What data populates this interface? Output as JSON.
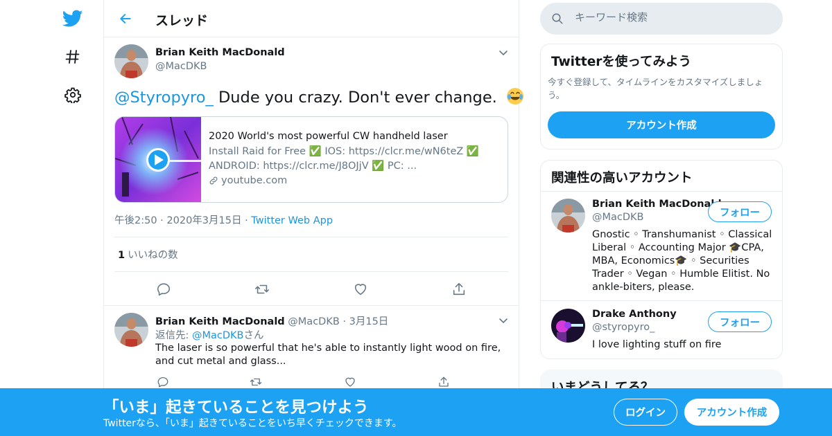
{
  "colors": {
    "accent": "#1da1f2",
    "link": "#1b95e0",
    "muted": "#657786",
    "border": "#e6ecf0"
  },
  "nav": {
    "icons": [
      "twitter-bird-icon",
      "hashtag-icon",
      "gear-icon"
    ]
  },
  "header": {
    "title": "スレッド"
  },
  "main_tweet": {
    "author_name": "Brian Keith MacDonald",
    "author_handle": "@MacDKB",
    "mention": "@Styropyro_",
    "text": "Dude you crazy. Don't ever change.",
    "emoji": "joy-emoji",
    "card": {
      "title": "2020 World's most powerful CW handheld laser",
      "description": "Install Raid for Free ✅ IOS: https://clcr.me/wN6teZ ✅ ANDROID: https://clcr.me/J8OJjV ✅ PC: ...",
      "domain": "youtube.com"
    },
    "time": "午後2:50",
    "date": "2020年3月15日",
    "source": "Twitter Web App",
    "separator": "·",
    "like_count": "1",
    "like_label": "いいねの数"
  },
  "reply_tweet": {
    "author_name": "Brian Keith MacDonald",
    "author_handle": "@MacDKB",
    "date": "3月15日",
    "reply_prefix": "返信先: ",
    "reply_to": "@MacDKB",
    "reply_suffix": "さん",
    "text": "The laser is so powerful that he's able to instantly light wood on fire, and cut metal and glass..."
  },
  "sidebar": {
    "search_placeholder": "キーワード検索",
    "signup": {
      "title": "Twitterを使ってみよう",
      "description": "今すぐ登録して、タイムラインをカスタマイズしましょう。",
      "button": "アカウント作成"
    },
    "related": {
      "title": "関連性の高いアカウント",
      "follow_label": "フォロー",
      "accounts": [
        {
          "name": "Brian Keith MacDonald",
          "handle": "@MacDKB",
          "bio": "Gnostic ◦ Transhumanist ◦ Classical Liberal ◦ Accounting Major 🎓CPA, MBA, Economics🎓 ◦ Securities Trader ◦ Vegan ◦ Humble Elitist.     No ankle-biters, please."
        },
        {
          "name": "Drake Anthony",
          "handle": "@styropyro_",
          "bio": "I love lighting stuff on fire"
        }
      ]
    },
    "trends_title": "いまどうしてる？"
  },
  "banner": {
    "title": "「いま」起きていることを見つけよう",
    "subtitle": "Twitterなら、「いま」起きていることをいち早くチェックできます。",
    "login": "ログイン",
    "signup": "アカウント作成"
  }
}
